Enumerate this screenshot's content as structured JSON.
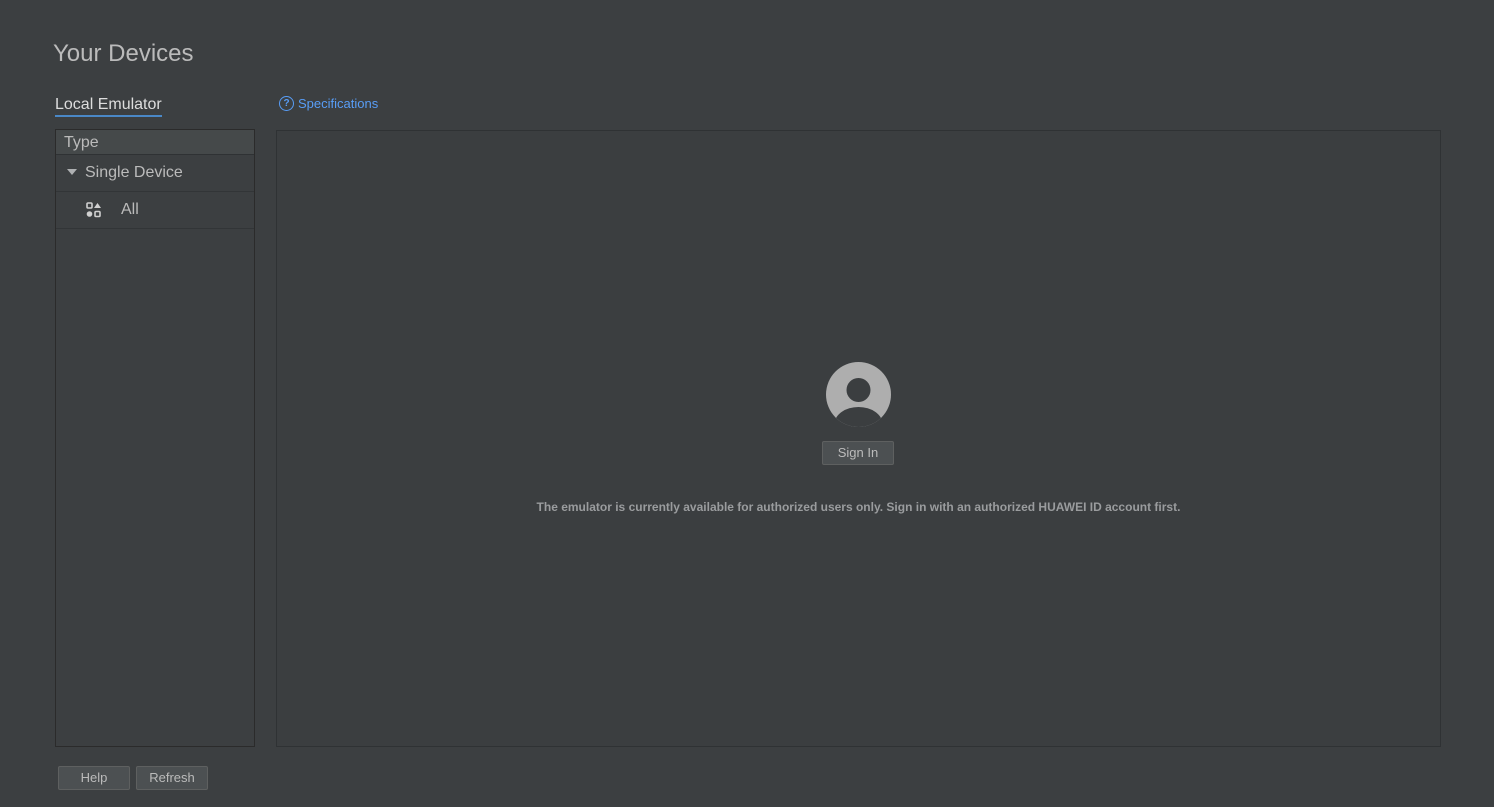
{
  "page": {
    "title": "Your Devices"
  },
  "tabs": {
    "local_emulator": "Local Emulator"
  },
  "links": {
    "specifications": "Specifications",
    "question_glyph": "?"
  },
  "left_panel": {
    "header": "Type",
    "groups": [
      {
        "label": "Single Device",
        "icon": "triangle-down-icon",
        "items": [
          {
            "label": "All",
            "icon": "grid-shapes-icon"
          }
        ]
      }
    ]
  },
  "main": {
    "avatar_icon": "user-avatar-icon",
    "sign_in_label": "Sign In",
    "notice": "The emulator is currently available for authorized users only. Sign in with an authorized HUAWEI ID account first."
  },
  "footer": {
    "help_label": "Help",
    "refresh_label": "Refresh"
  },
  "colors": {
    "background": "#3c3f41",
    "accent_link": "#589df6",
    "tab_underline": "#4a88c7",
    "avatar": "#aeaeae"
  }
}
